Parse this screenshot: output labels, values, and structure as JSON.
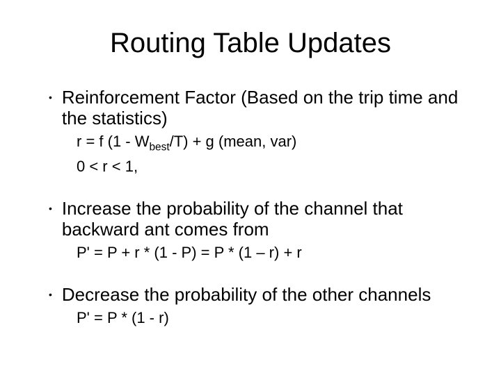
{
  "title": "Routing Table Updates",
  "bullets": [
    {
      "text": "Reinforcement Factor (Based on the trip time and the statistics)",
      "sublines": [
        {
          "prefix": "r = f (1 - W",
          "sub": "best",
          "suffix": "/T) + g (mean, var)"
        },
        {
          "prefix": "0 < r < 1,",
          "sub": "",
          "suffix": ""
        }
      ]
    },
    {
      "text": "Increase the probability of the channel that backward ant comes from",
      "sublines": [
        {
          "prefix": "P'  =  P + r * (1 - P) = P * (1 – r) + r",
          "sub": "",
          "suffix": ""
        }
      ]
    },
    {
      "text": "Decrease the probability of the other channels",
      "sublines": [
        {
          "prefix": "P' = P * (1 - r)",
          "sub": "",
          "suffix": ""
        }
      ]
    }
  ]
}
